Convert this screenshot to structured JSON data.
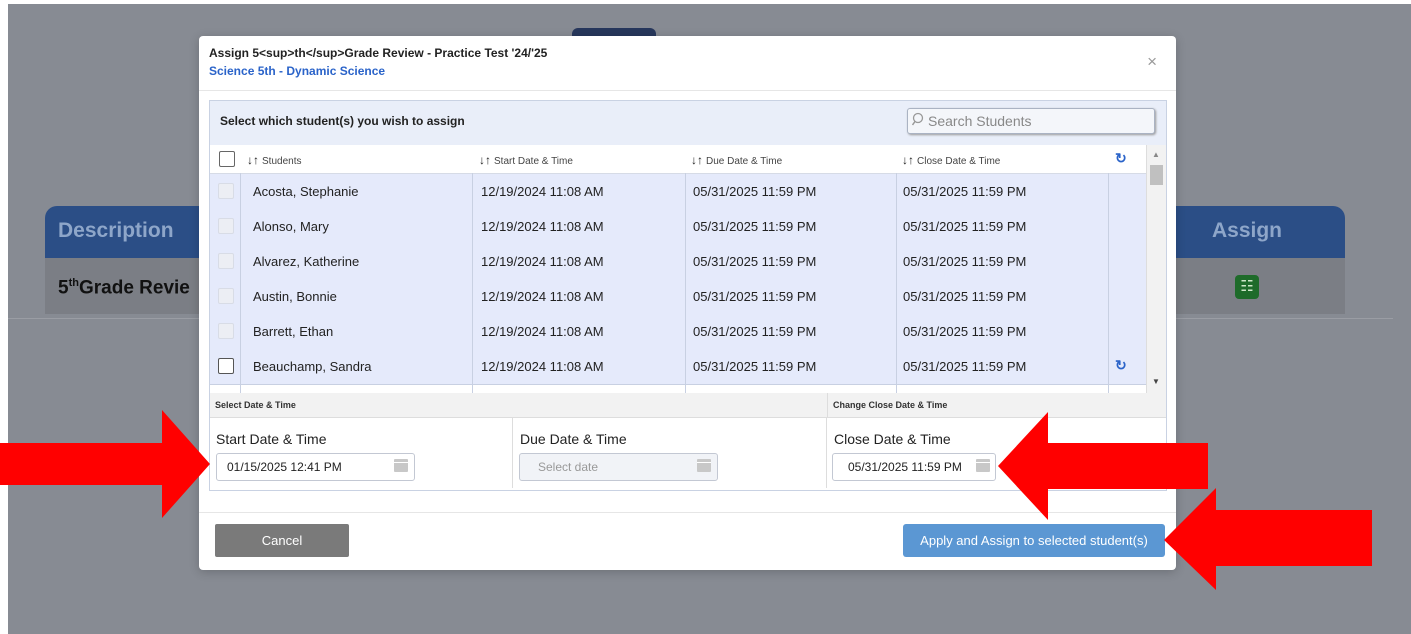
{
  "background": {
    "table_headers": {
      "description": "Description",
      "assign": "Assign"
    },
    "row_title_prefix": "5",
    "row_title_sup": "th",
    "row_title_rest": "Grade Revie"
  },
  "modal": {
    "title": "Assign 5<sup>th</sup>Grade Review - Practice Test '24/'25",
    "subtitle": "Science 5th - Dynamic Science",
    "close_symbol": "×",
    "instruction": "Select which student(s) you wish to assign",
    "search": {
      "placeholder": "Search Students",
      "value": ""
    },
    "columns": {
      "students": "Students",
      "start": "Start Date & Time",
      "due": "Due Date & Time",
      "close": "Close Date & Time"
    },
    "rows": [
      {
        "name": "Acosta, Stephanie",
        "start": "12/19/2024 11:08 AM",
        "due": "05/31/2025 11:59 PM",
        "close": "05/31/2025 11:59 PM",
        "selectable": false,
        "refresh": false
      },
      {
        "name": "Alonso, Mary",
        "start": "12/19/2024 11:08 AM",
        "due": "05/31/2025 11:59 PM",
        "close": "05/31/2025 11:59 PM",
        "selectable": false,
        "refresh": false
      },
      {
        "name": "Alvarez, Katherine",
        "start": "12/19/2024 11:08 AM",
        "due": "05/31/2025 11:59 PM",
        "close": "05/31/2025 11:59 PM",
        "selectable": false,
        "refresh": false
      },
      {
        "name": "Austin, Bonnie",
        "start": "12/19/2024 11:08 AM",
        "due": "05/31/2025 11:59 PM",
        "close": "05/31/2025 11:59 PM",
        "selectable": false,
        "refresh": false
      },
      {
        "name": "Barrett, Ethan",
        "start": "12/19/2024 11:08 AM",
        "due": "05/31/2025 11:59 PM",
        "close": "05/31/2025 11:59 PM",
        "selectable": false,
        "refresh": false
      },
      {
        "name": "Beauchamp, Sandra",
        "start": "12/19/2024 11:08 AM",
        "due": "05/31/2025 11:59 PM",
        "close": "05/31/2025 11:59 PM",
        "selectable": true,
        "refresh": true
      }
    ],
    "date_section": {
      "select_header": "Select Date & Time",
      "change_header": "Change Close Date & Time",
      "start_label": "Start Date & Time",
      "start_value": "01/15/2025 12:41 PM",
      "due_label": "Due Date & Time",
      "due_placeholder": "Select date",
      "close_label": "Close Date & Time",
      "close_value": "05/31/2025 11:59 PM"
    },
    "buttons": {
      "cancel": "Cancel",
      "apply": "Apply and Assign to selected student(s)"
    }
  },
  "colors": {
    "accent_blue": "#2a63c9",
    "apply_button": "#5b97d3",
    "cancel_button": "#7a7a7a",
    "annotation_arrow": "#ff0000",
    "row_highlight": "#e5eafb"
  },
  "icons": [
    "search-icon",
    "sort-icon",
    "refresh-icon",
    "calendar-icon",
    "close-icon",
    "checklist-icon"
  ]
}
